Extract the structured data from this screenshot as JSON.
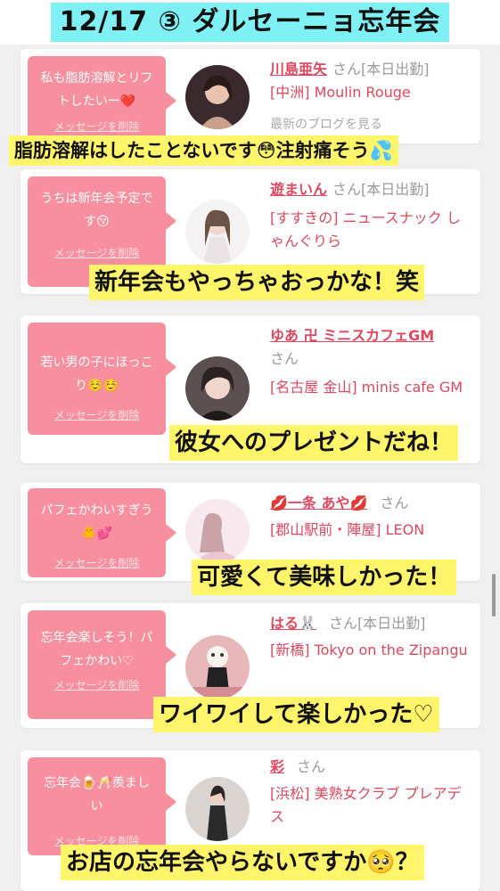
{
  "header": {
    "title": "12/17 ③ ダルセーニョ忘年会"
  },
  "colors": {
    "bubble": "#f78f9e",
    "name": "#e0475e",
    "caption_bg": "#fff56b",
    "title_bg": "#7ff0f3"
  },
  "common": {
    "san": "さん",
    "delete_label": "メッセージを削除",
    "blog_label": "最新のブログを見る"
  },
  "messages": [
    {
      "text": "私も脂肪溶解とリフトしたいー❤️",
      "name": "川島亜矢",
      "suffix": "さん[本日出勤]",
      "shop": "[中洲] Moulin Rouge",
      "caption": "脂肪溶解はしたことないです😳注射痛そう💦"
    },
    {
      "text": "うちは新年会予定です😚",
      "name": "遊まいん",
      "suffix": "さん[本日出勤]",
      "shop": "[すすきの] ニュースナック しゃんぐりら",
      "caption": "新年会もやっちゃおっかな！笑"
    },
    {
      "text": "若い男の子にほっこり☺️☺️",
      "name": "ゆあ 卍 ミニスカフェGM",
      "suffix": "さん",
      "shop": "[名古屋 金山] minis cafe GM",
      "caption": "彼女へのプレゼントだね！"
    },
    {
      "text": "パフェかわいすぎう🐥💕",
      "name": "💋一条 あや💋",
      "suffix": "さん",
      "shop": "[郡山駅前・陣屋] LEON",
      "caption": "可愛くて美味しかった！"
    },
    {
      "text": "忘年会楽しそう！パフェかわい♡",
      "name": "はる🐰",
      "suffix": "さん[本日出勤]",
      "shop": "[新橋] Tokyo on the Zipangu",
      "caption": "ワイワイして楽しかった♡"
    },
    {
      "text": "忘年会🍺🥂羨ましい",
      "name": "彩",
      "suffix": "さん",
      "shop": "[浜松] 美熟女クラブ プレアデス",
      "caption": "お店の忘年会やらないですか🥺？"
    }
  ]
}
